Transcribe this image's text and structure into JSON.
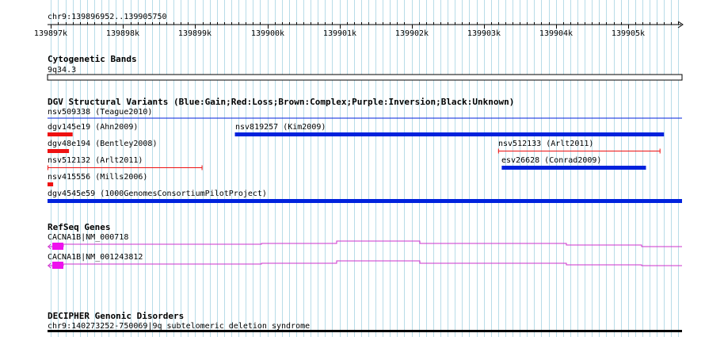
{
  "view": {
    "location": "chr9:139896952..139905750",
    "start": 139896952,
    "end": 139905750
  },
  "ruler": {
    "ticks": [
      {
        "pos": 139897000,
        "label": "139897k"
      },
      {
        "pos": 139898000,
        "label": "139898k"
      },
      {
        "pos": 139899000,
        "label": "139899k"
      },
      {
        "pos": 139900000,
        "label": "139900k"
      },
      {
        "pos": 139901000,
        "label": "139901k"
      },
      {
        "pos": 139902000,
        "label": "139902k"
      },
      {
        "pos": 139903000,
        "label": "139903k"
      },
      {
        "pos": 139904000,
        "label": "139904k"
      },
      {
        "pos": 139905000,
        "label": "139905k"
      }
    ]
  },
  "colors": {
    "grid": "#b8dce8",
    "gain": "#0022dd",
    "loss": "#ee1111",
    "gene": "#cc33cc",
    "exon": "#ee11ee",
    "black": "#000000"
  },
  "tracks": {
    "cytoband": {
      "title": "Cytogenetic Bands",
      "band_label": "9q34.3"
    },
    "dgv": {
      "title": "DGV Structural Variants (Blue:Gain;Red:Loss;Brown:Complex;Purple:Inversion;Black:Unknown)",
      "subtitle": "nsv509338 (Teague2010)",
      "features": [
        {
          "id": "dgv145e19",
          "label": "dgv145e19 (Ahn2009)",
          "type": "loss",
          "style": "thick",
          "start": 139896952,
          "end": 139897300
        },
        {
          "id": "nsv819257",
          "label": "nsv819257 (Kim2009)",
          "type": "gain",
          "style": "thick",
          "start": 139899550,
          "end": 139905500
        },
        {
          "id": "dgv48e194",
          "label": "dgv48e194 (Bentley2008)",
          "type": "loss",
          "style": "thick",
          "start": 139896952,
          "end": 139897250
        },
        {
          "id": "nsv512133",
          "label": "nsv512133 (Arlt2011)",
          "type": "loss",
          "style": "thin",
          "start": 139903200,
          "end": 139905450
        },
        {
          "id": "nsv512132",
          "label": "nsv512132 (Arlt2011)",
          "type": "loss",
          "style": "thin",
          "start": 139896952,
          "end": 139899100
        },
        {
          "id": "esv26628",
          "label": "esv26628 (Conrad2009)",
          "type": "gain",
          "style": "thick",
          "start": 139903250,
          "end": 139905250
        },
        {
          "id": "nsv415556",
          "label": "nsv415556 (Mills2006)",
          "type": "loss",
          "style": "thick",
          "start": 139896952,
          "end": 139897030
        },
        {
          "id": "dgv4545e59",
          "label": "dgv4545e59 (1000GenomesConsortiumPilotProject)",
          "type": "gain",
          "style": "thick",
          "start": 139896952,
          "end": 139905750
        }
      ]
    },
    "refseq": {
      "title": "RefSeq Genes",
      "genes": [
        {
          "id": "CACNA1B|NM_000718",
          "label": "CACNA1B|NM_000718"
        },
        {
          "id": "CACNA1B|NM_001243812",
          "label": "CACNA1B|NM_001243812"
        }
      ]
    },
    "decipher": {
      "title": "DECIPHER Genonic Disorders",
      "feature_label": "chr9:140273252-750069|9q subtelomeric deletion syndrome"
    }
  }
}
